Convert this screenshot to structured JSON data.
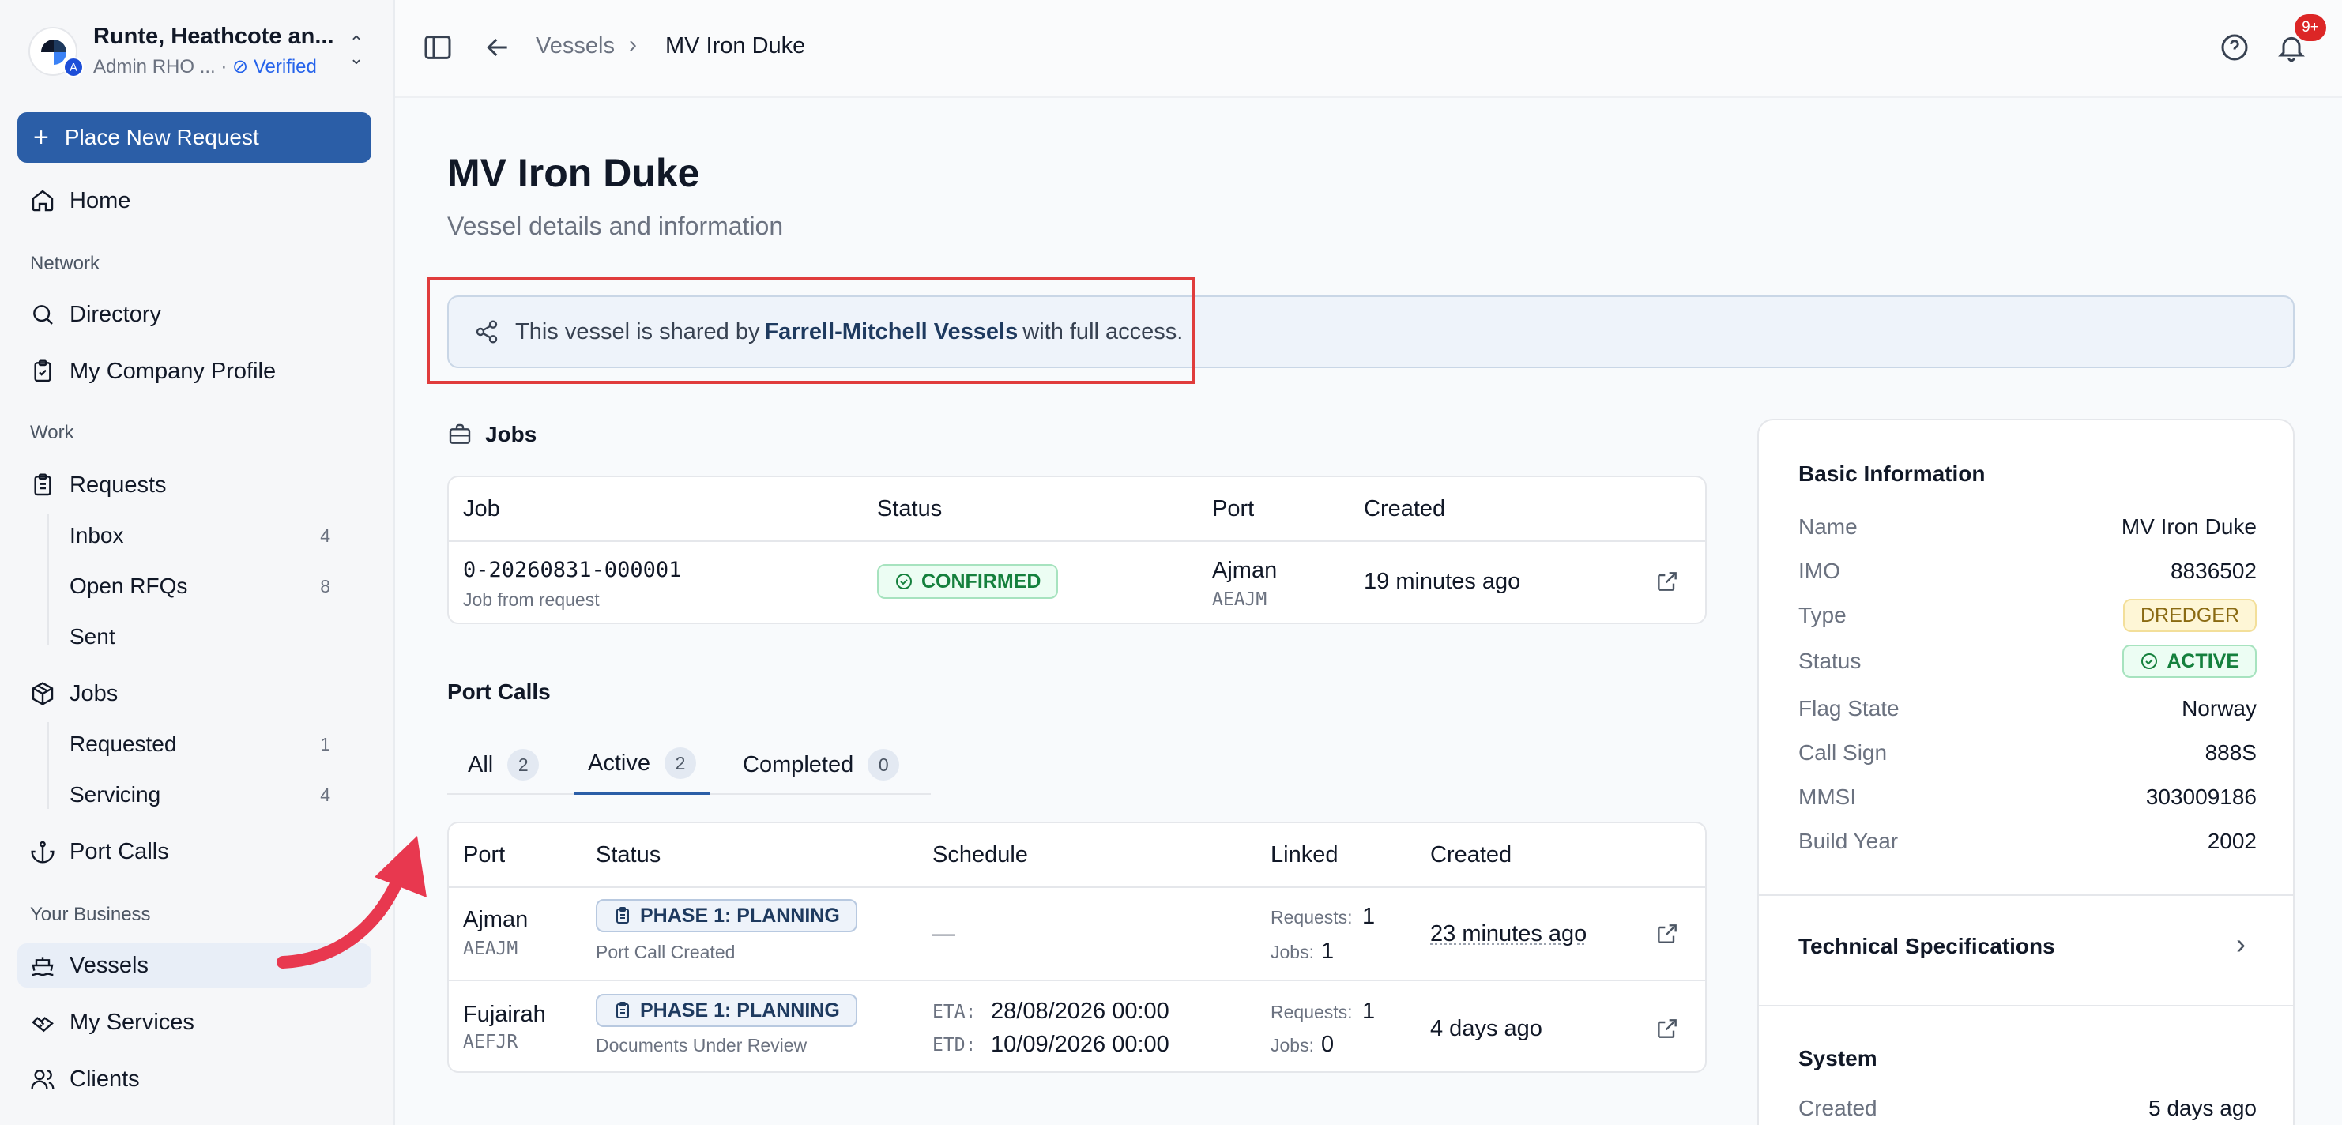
{
  "org": {
    "name": "Runte, Heathcote an...",
    "role": "Admin RHO ...",
    "separator": "·",
    "verified": "Verified",
    "badge": "A"
  },
  "sidebar": {
    "new_request": "Place New Request",
    "home": "Home",
    "sections": {
      "network": "Network",
      "work": "Work",
      "business": "Your Business"
    },
    "directory": "Directory",
    "company_profile": "My Company Profile",
    "requests": "Requests",
    "request_items": [
      {
        "label": "Inbox",
        "count": "4"
      },
      {
        "label": "Open RFQs",
        "count": "8"
      },
      {
        "label": "Sent",
        "count": ""
      }
    ],
    "jobs": "Jobs",
    "job_items": [
      {
        "label": "Requested",
        "count": "1"
      },
      {
        "label": "Servicing",
        "count": "4"
      }
    ],
    "port_calls": "Port Calls",
    "vessels": "Vessels",
    "my_services": "My Services",
    "clients": "Clients"
  },
  "topbar": {
    "breadcrumb": {
      "parent": "Vessels",
      "current": "MV Iron Duke"
    },
    "notifications_badge": "9+"
  },
  "page": {
    "title": "MV Iron Duke",
    "subtitle": "Vessel details and information"
  },
  "share_banner": {
    "prefix": "This vessel is shared by",
    "company": "Farrell-Mitchell Vessels",
    "suffix": "with full access."
  },
  "jobs": {
    "title": "Jobs",
    "headers": {
      "job": "Job",
      "status": "Status",
      "port": "Port",
      "created": "Created"
    },
    "rows": [
      {
        "job_id": "0-20260831-000001",
        "job_desc": "Job from request",
        "status": "CONFIRMED",
        "port": "Ajman",
        "port_code": "AEAJM",
        "created": "19 minutes ago"
      }
    ]
  },
  "port_calls": {
    "title": "Port Calls",
    "tabs": [
      {
        "label": "All",
        "count": "2"
      },
      {
        "label": "Active",
        "count": "2"
      },
      {
        "label": "Completed",
        "count": "0"
      }
    ],
    "headers": {
      "port": "Port",
      "status": "Status",
      "schedule": "Schedule",
      "linked": "Linked",
      "created": "Created"
    },
    "rows": [
      {
        "port": "Ajman",
        "code": "AEAJM",
        "status": "PHASE 1: PLANNING",
        "status_sub": "Port Call Created",
        "schedule": "—",
        "eta_label": "",
        "eta": "",
        "etd_label": "",
        "etd": "",
        "requests_label": "Requests:",
        "requests": "1",
        "jobs_label": "Jobs:",
        "jobs": "1",
        "created": "23 minutes ago"
      },
      {
        "port": "Fujairah",
        "code": "AEFJR",
        "status": "PHASE 1: PLANNING",
        "status_sub": "Documents Under Review",
        "schedule": "",
        "eta_label": "ETA:",
        "eta": "28/08/2026 00:00",
        "etd_label": "ETD:",
        "etd": "10/09/2026 00:00",
        "requests_label": "Requests:",
        "requests": "1",
        "jobs_label": "Jobs:",
        "jobs": "0",
        "created": "4 days ago"
      }
    ]
  },
  "basic_info": {
    "title": "Basic Information",
    "name_label": "Name",
    "name": "MV Iron Duke",
    "imo_label": "IMO",
    "imo": "8836502",
    "type_label": "Type",
    "type": "DREDGER",
    "status_label": "Status",
    "status": "ACTIVE",
    "flag_label": "Flag State",
    "flag": "Norway",
    "callsign_label": "Call Sign",
    "callsign": "888S",
    "mmsi_label": "MMSI",
    "mmsi": "303009186",
    "build_label": "Build Year",
    "build": "2002"
  },
  "technical": {
    "title": "Technical Specifications"
  },
  "system": {
    "title": "System",
    "created_label": "Created",
    "created": "5 days ago"
  },
  "colors": {
    "primary": "#2b5ea7",
    "highlight": "#e03c3c",
    "arrow": "#e8384f",
    "success": "#15803d"
  }
}
